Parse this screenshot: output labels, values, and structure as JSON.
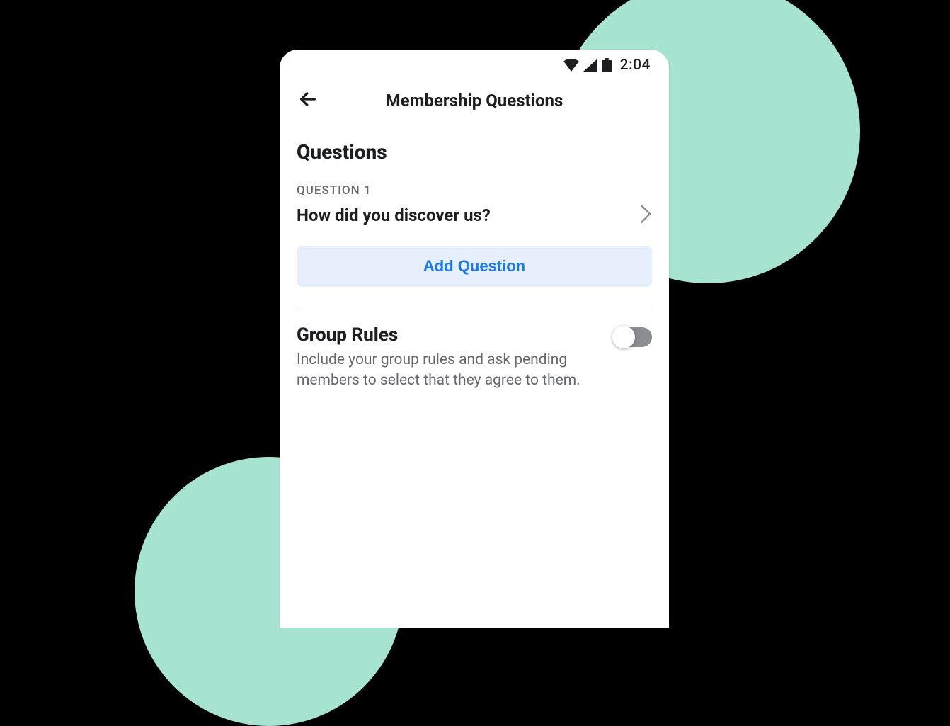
{
  "status_bar": {
    "time": "2:04"
  },
  "header": {
    "title": "Membership Questions"
  },
  "questions_section": {
    "heading": "Questions",
    "items": [
      {
        "label": "QUESTION 1",
        "text": "How did you discover us?"
      }
    ],
    "add_button_label": "Add Question"
  },
  "group_rules": {
    "title": "Group Rules",
    "description": "Include your group rules and ask pending members to select that they agree to them.",
    "toggle_on": false
  }
}
